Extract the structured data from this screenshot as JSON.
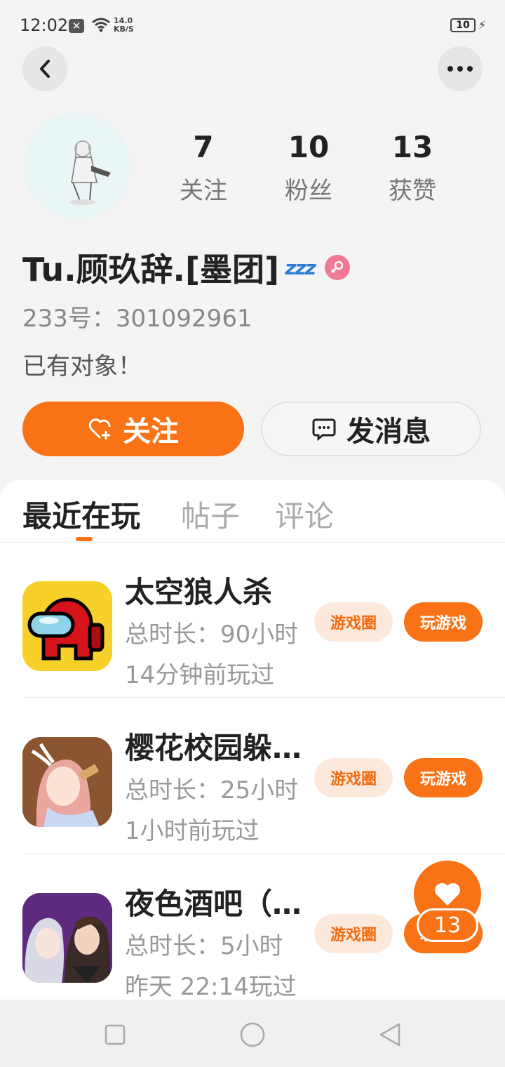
{
  "status_bar": {
    "time": "12:02",
    "speed_value": "14.0",
    "speed_unit": "KB/S",
    "battery": "10"
  },
  "header": {
    "back_icon": "chevron-left-icon",
    "more_icon": "more-dots-icon"
  },
  "profile": {
    "stats": [
      {
        "value": "7",
        "label": "关注"
      },
      {
        "value": "10",
        "label": "粉丝"
      },
      {
        "value": "13",
        "label": "获赞"
      }
    ],
    "username": "Tu.顾玖辞.[墨团]",
    "zzz": "zzz",
    "gender_icon": "female-icon",
    "uid": "233号：301092961",
    "bio": "已有对象！"
  },
  "actions": {
    "follow_label": "关注",
    "message_label": "发消息"
  },
  "tabs": [
    {
      "label": "最近在玩",
      "active": true
    },
    {
      "label": "帖子",
      "active": false
    },
    {
      "label": "评论",
      "active": false
    }
  ],
  "games": [
    {
      "title": "太空狼人杀",
      "duration": "总时长：90小时",
      "last_played": "14分钟前玩过",
      "circle_label": "游戏圈",
      "play_label": "玩游戏"
    },
    {
      "title": "樱花校园躲猫猫",
      "duration": "总时长：25小时",
      "last_played": "1小时前玩过",
      "circle_label": "游戏圈",
      "play_label": "玩游戏"
    },
    {
      "title": "夜色酒吧（恋爱）",
      "duration": "总时长：5小时",
      "last_played": "昨天 22:14玩过",
      "circle_label": "游戏圈",
      "play_label": "玩游戏"
    }
  ],
  "fab": {
    "count": "13",
    "icon": "heart-icon"
  },
  "colors": {
    "accent": "#f97316",
    "pill_bg": "#fde9dc",
    "gender": "#f07a95"
  }
}
